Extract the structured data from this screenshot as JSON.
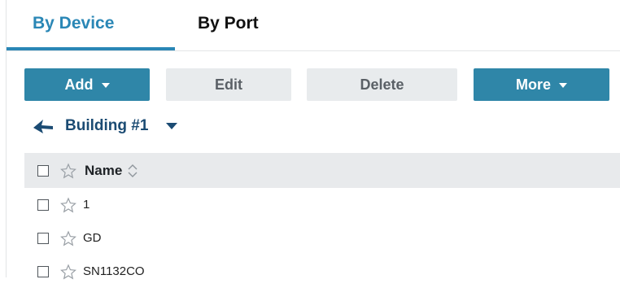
{
  "tabs": {
    "by_device": "By Device",
    "by_port": "By Port"
  },
  "toolbar": {
    "add": "Add",
    "edit": "Edit",
    "delete": "Delete",
    "more": "More"
  },
  "breadcrumb": {
    "label": "Building #1"
  },
  "table": {
    "header": {
      "name": "Name"
    },
    "rows": [
      {
        "name": "1"
      },
      {
        "name": "GD"
      },
      {
        "name": "SN1132CO"
      }
    ]
  },
  "colors": {
    "accent": "#2a87b6",
    "button_primary": "#2f86a8",
    "button_secondary": "#e8ebed",
    "breadcrumb": "#1b4b73"
  }
}
